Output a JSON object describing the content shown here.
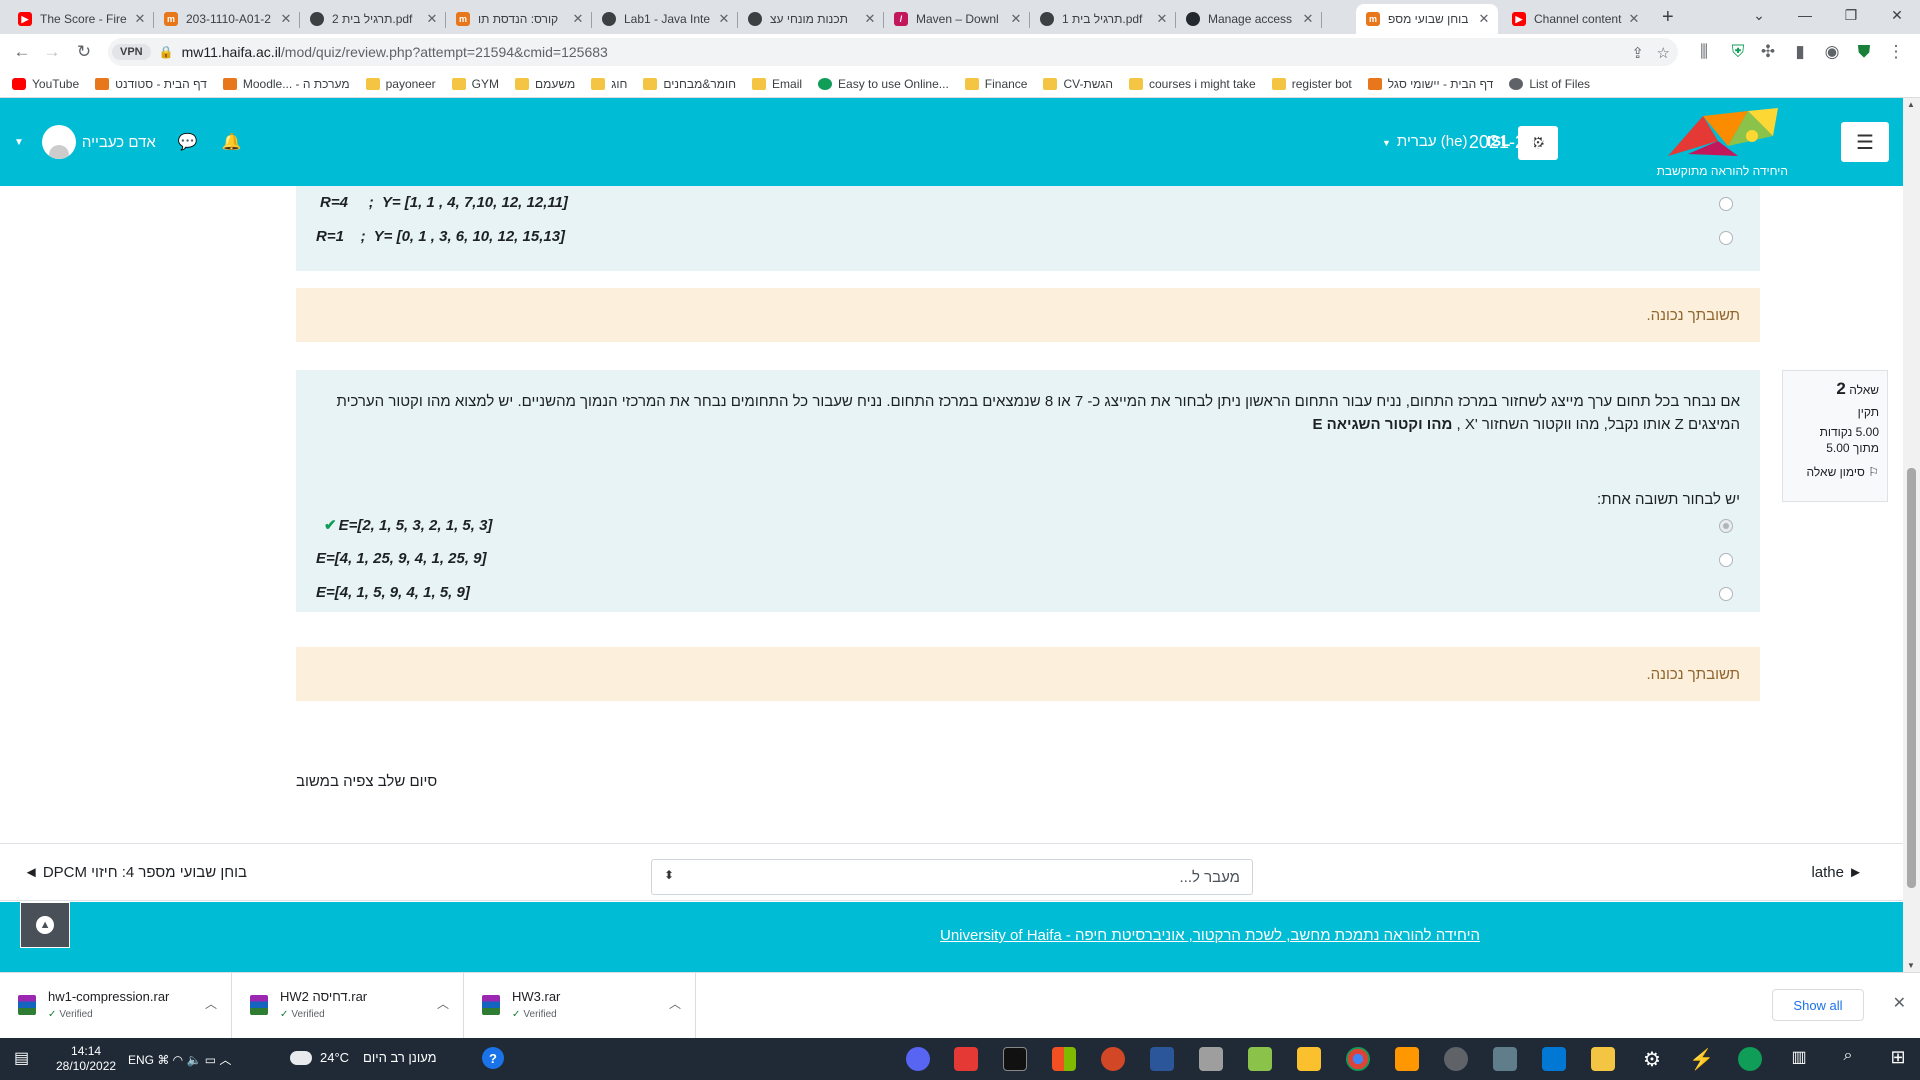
{
  "browser": {
    "tabs": [
      {
        "title": "The Score - Fire",
        "favicon": "youtube-icon",
        "color": "#ff0000"
      },
      {
        "title": "203-1110-A01-2",
        "favicon": "moodle-icon",
        "color": "#e8761a"
      },
      {
        "title": "תרגיל בית 2.pdf",
        "favicon": "globe-icon",
        "color": "#3c4043"
      },
      {
        "title": "קורס: הנדסת תו",
        "favicon": "moodle-icon",
        "color": "#e8761a"
      },
      {
        "title": "Lab1 - Java Inte",
        "favicon": "globe-icon",
        "color": "#3c4043"
      },
      {
        "title": "תכנות מונחי עצ",
        "favicon": "globe-icon",
        "color": "#3c4043"
      },
      {
        "title": "Maven – Downl",
        "favicon": "maven-icon",
        "color": "#c2185b"
      },
      {
        "title": "תרגיל בית 1.pdf",
        "favicon": "globe-icon",
        "color": "#3c4043"
      },
      {
        "title": "Manage access",
        "favicon": "github-icon",
        "color": "#24292f"
      },
      {
        "title": "בוחן שבועי מספ",
        "favicon": "moodle-icon",
        "color": "#e8761a",
        "active": true
      },
      {
        "title": "Channel content",
        "favicon": "youtube-icon",
        "color": "#ff0000"
      }
    ],
    "url_host": "mw11.haifa.ac.il",
    "url_path": "/mod/quiz/review.php?attempt=21594&cmid=125683",
    "vpn_label": "VPN"
  },
  "bookmarks": [
    {
      "label": "YouTube",
      "icon": "youtube"
    },
    {
      "label": "דף הבית - סטודנט",
      "icon": "moodle"
    },
    {
      "label": "Moodle... - מערכת ה",
      "icon": "moodle"
    },
    {
      "label": "payoneer",
      "icon": "folder"
    },
    {
      "label": "GYM",
      "icon": "folder"
    },
    {
      "label": "משעמם",
      "icon": "folder"
    },
    {
      "label": "חוג",
      "icon": "folder"
    },
    {
      "label": "חומר&מבחנים",
      "icon": "folder"
    },
    {
      "label": "Email",
      "icon": "folder"
    },
    {
      "label": "Easy to use Online...",
      "icon": "green"
    },
    {
      "label": "Finance",
      "icon": "folder"
    },
    {
      "label": "CV-הגשת",
      "icon": "folder"
    },
    {
      "label": "courses i might take",
      "icon": "folder"
    },
    {
      "label": "register bot",
      "icon": "folder"
    },
    {
      "label": "דף הבית - יישומי סגל",
      "icon": "moodle"
    },
    {
      "label": "List of Files",
      "icon": "globe"
    }
  ],
  "header": {
    "year": "2021-2022",
    "lang": "עברית (he)",
    "isl": "ISL",
    "user_name": "אדם כעבייה",
    "logo_caption": "היחידה להוראה מתוקשבת"
  },
  "q1": {
    "options": [
      "R=4     ;  Y= [1, 1 , 4, 7,10, 12, 12,11]",
      "R=1    ;  Y= [0, 1 , 3, 6, 10, 12, 15,13]"
    ],
    "feedback": "תשובתך נכונה."
  },
  "q2": {
    "number": "2",
    "number_label": "שאלה",
    "status": "תקין",
    "points": "5.00 נקודות",
    "out_of": "מתוך 5.00",
    "flag_label": "סימון שאלה",
    "text_main": "אם נבחר בכל תחום ערך מייצג לשחזור במרכז התחום, נניח עבור התחום הראשון ניתן לבחור את המייצג   כ- 7 או 8 שנמצאים במרכז התחום. נניח שעבור כל התחומים נבחר את המרכזי הנמוך מהשניים.  יש למצוא מהו וקטור הערכית המיצגים Z  אותו נקבל, מהו ווקטור השחזור 'X , ",
    "text_bold": "מהו וקטור השגיאה E",
    "prompt": "יש לבחור תשובה אחת:",
    "options": [
      "E=[2, 1, 5, 3, 2, 1, 5, 3]",
      "E=[4, 1, 25, 9, 4, 1, 25, 9]",
      "E=[4, 1, 5, 9, 4, 1, 5, 9]"
    ],
    "feedback": "תשובתך נכונה."
  },
  "finish_text": "סיום שלב צפיה במשוב",
  "nav": {
    "prev": "בוחן שבועי מספר 4: חיזוי DPCM ◄",
    "next": "► lathe",
    "jump_placeholder": "מעבר ל..."
  },
  "footer_link": "היחידה להוראה נתמכת מחשב, לשכת הרקטור, אוניברסיטת חיפה - University of Haifa",
  "downloads": [
    {
      "name": "hw1-compression.rar",
      "status": "Verified"
    },
    {
      "name": "HW2 דחיסה.rar",
      "status": "Verified"
    },
    {
      "name": "HW3.rar",
      "status": "Verified"
    }
  ],
  "show_all": "Show all",
  "taskbar": {
    "time": "14:14",
    "date": "28/10/2022",
    "lang": "ENG",
    "temp": "24°C",
    "weather_text": "מעונן רב היום"
  },
  "colors": {
    "accent": "#00bcd4",
    "question_bg": "#e7f3f5",
    "feedback_bg": "#fcefdc",
    "feedback_text": "#8e662e"
  }
}
